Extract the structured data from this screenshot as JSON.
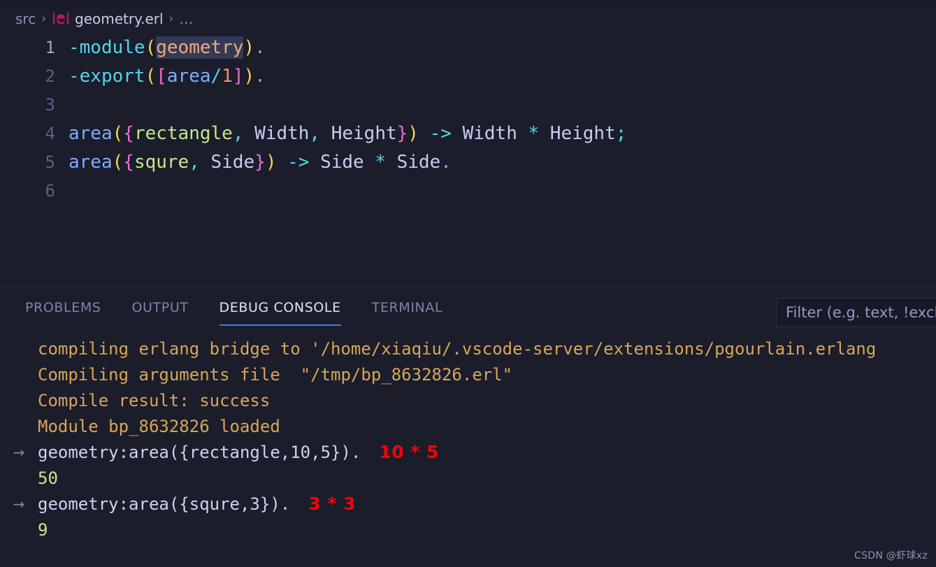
{
  "window": {
    "background": "#1b1d2b"
  },
  "tabstrip": {
    "dividers": [
      385,
      615,
      845,
      1075,
      1220
    ]
  },
  "breadcrumb": {
    "root": "src",
    "separator": "›",
    "file": "geometry.erl",
    "file_icon": "erlang-file-icon",
    "trailing": "…"
  },
  "editor": {
    "language": "erlang",
    "active_line": 1,
    "selection_token": "geometry",
    "lines": [
      {
        "number": "1",
        "tokens": [
          {
            "text": "-module",
            "cls": "t-attr"
          },
          {
            "text": "(",
            "cls": "t-paren"
          },
          {
            "text": "geometry",
            "cls": "t-atom",
            "selected": true
          },
          {
            "text": ")",
            "cls": "t-paren"
          },
          {
            "text": ".",
            "cls": "t-dot"
          }
        ]
      },
      {
        "number": "2",
        "tokens": [
          {
            "text": "-export",
            "cls": "t-attr"
          },
          {
            "text": "(",
            "cls": "t-paren"
          },
          {
            "text": "[",
            "cls": "t-brack"
          },
          {
            "text": "area",
            "cls": "t-func"
          },
          {
            "text": "/",
            "cls": "t-slash"
          },
          {
            "text": "1",
            "cls": "t-num"
          },
          {
            "text": "]",
            "cls": "t-brack"
          },
          {
            "text": ")",
            "cls": "t-paren"
          },
          {
            "text": ".",
            "cls": "t-dot"
          }
        ]
      },
      {
        "number": "3",
        "tokens": []
      },
      {
        "number": "4",
        "tokens": [
          {
            "text": "area",
            "cls": "t-func"
          },
          {
            "text": "(",
            "cls": "t-paren"
          },
          {
            "text": "{",
            "cls": "t-brack"
          },
          {
            "text": "rectangle",
            "cls": "t-atom2"
          },
          {
            "text": ",",
            "cls": "t-op"
          },
          {
            "text": " Width",
            "cls": "t-var"
          },
          {
            "text": ",",
            "cls": "t-op"
          },
          {
            "text": " Height",
            "cls": "t-var"
          },
          {
            "text": "}",
            "cls": "t-brack"
          },
          {
            "text": ")",
            "cls": "t-paren"
          },
          {
            "text": " ",
            "cls": "t-var"
          },
          {
            "text": "->",
            "cls": "t-op"
          },
          {
            "text": " Width ",
            "cls": "t-var"
          },
          {
            "text": "*",
            "cls": "t-op"
          },
          {
            "text": " Height",
            "cls": "t-var"
          },
          {
            "text": ";",
            "cls": "t-semi"
          }
        ]
      },
      {
        "number": "5",
        "tokens": [
          {
            "text": "area",
            "cls": "t-func"
          },
          {
            "text": "(",
            "cls": "t-paren"
          },
          {
            "text": "{",
            "cls": "t-brack"
          },
          {
            "text": "squre",
            "cls": "t-atom2"
          },
          {
            "text": ",",
            "cls": "t-op"
          },
          {
            "text": " Side",
            "cls": "t-var"
          },
          {
            "text": "}",
            "cls": "t-brack"
          },
          {
            "text": ")",
            "cls": "t-paren"
          },
          {
            "text": " ",
            "cls": "t-var"
          },
          {
            "text": "->",
            "cls": "t-op"
          },
          {
            "text": " Side ",
            "cls": "t-var"
          },
          {
            "text": "*",
            "cls": "t-op"
          },
          {
            "text": " Side",
            "cls": "t-var"
          },
          {
            "text": ".",
            "cls": "t-dot"
          }
        ]
      },
      {
        "number": "6",
        "tokens": []
      }
    ]
  },
  "panel": {
    "tabs": [
      {
        "label": "PROBLEMS",
        "active": false,
        "name": "tab-problems"
      },
      {
        "label": "OUTPUT",
        "active": false,
        "name": "tab-output"
      },
      {
        "label": "DEBUG CONSOLE",
        "active": true,
        "name": "tab-debug-console"
      },
      {
        "label": "TERMINAL",
        "active": false,
        "name": "tab-terminal"
      }
    ],
    "active_tab": "DEBUG CONSOLE",
    "active_underline_color": "#3c7fe0",
    "filter": {
      "value": "",
      "placeholder": "Filter (e.g. text, !exclude)"
    },
    "console_lines": [
      {
        "gutter": "",
        "text": "compiling erlang bridge to '/home/xiaqiu/.vscode-server/extensions/pgourlain.erlang",
        "cls": "c-log",
        "annotation": ""
      },
      {
        "gutter": "",
        "text": "Compiling arguments file  \"/tmp/bp_8632826.erl\"",
        "cls": "c-log",
        "annotation": ""
      },
      {
        "gutter": "",
        "text": "Compile result: success",
        "cls": "c-log",
        "annotation": ""
      },
      {
        "gutter": "",
        "text": "Module bp_8632826 loaded",
        "cls": "c-log",
        "annotation": ""
      },
      {
        "gutter": "→",
        "text": "geometry:area({rectangle,10,5}).",
        "cls": "c-input",
        "annotation": "10 * 5"
      },
      {
        "gutter": "",
        "text": "50",
        "cls": "c-result",
        "annotation": ""
      },
      {
        "gutter": "→",
        "text": "geometry:area({squre,3}).",
        "cls": "c-input",
        "annotation": "3 * 3"
      },
      {
        "gutter": "",
        "text": "9",
        "cls": "c-result",
        "annotation": ""
      }
    ]
  },
  "watermark": {
    "text": "CSDN @虾球xz"
  },
  "colors": {
    "background": "#1b1d2b",
    "log": "#d8a657",
    "result": "#c3e88d",
    "annotation": "#fb0007",
    "accent": "#3c7fe0"
  }
}
